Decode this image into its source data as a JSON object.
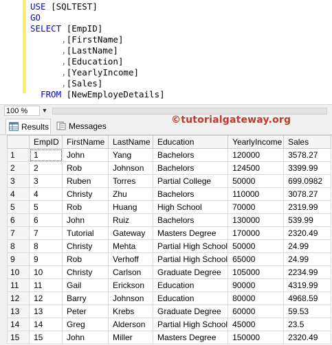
{
  "editor": {
    "lines": [
      {
        "t1": "USE ",
        "t2": "[SQLTEST]"
      },
      {
        "t1": "GO",
        "t2": ""
      },
      {
        "t1": "SELECT ",
        "t2": "[EmpID]"
      },
      {
        "t1": "      ,",
        "t2": "[FirstName]"
      },
      {
        "t1": "      ,",
        "t2": "[LastName]"
      },
      {
        "t1": "      ,",
        "t2": "[Education]"
      },
      {
        "t1": "      ,",
        "t2": "[YearlyIncome]"
      },
      {
        "t1": "      ,",
        "t2": "[Sales]"
      },
      {
        "t1": "FROM ",
        "t2": "[NewEmployeDetails]"
      }
    ]
  },
  "zoom": {
    "value": "100 %"
  },
  "tabs": {
    "results": "Results",
    "messages": "Messages"
  },
  "watermark": "©tutorialgateway.org",
  "grid": {
    "columns": [
      "EmpID",
      "FirstName",
      "LastName",
      "Education",
      "YearlyIncome",
      "Sales"
    ],
    "rows": [
      [
        "1",
        "1",
        "John",
        "Yang",
        "Bachelors",
        "120000",
        "3578.27"
      ],
      [
        "2",
        "2",
        "Rob",
        "Johnson",
        "Bachelors",
        "124500",
        "3399.99"
      ],
      [
        "3",
        "3",
        "Ruben",
        "Torres",
        "Partial College",
        "50000",
        "699.0982"
      ],
      [
        "4",
        "4",
        "Christy",
        "Zhu",
        "Bachelors",
        "110000",
        "3078.27"
      ],
      [
        "5",
        "5",
        "Rob",
        "Huang",
        "High School",
        "70000",
        "2319.99"
      ],
      [
        "6",
        "6",
        "John",
        "Ruiz",
        "Bachelors",
        "130000",
        "539.99"
      ],
      [
        "7",
        "7",
        "Tutorial",
        "Gateway",
        "Masters Degree",
        "170000",
        "2320.49"
      ],
      [
        "8",
        "8",
        "Christy",
        "Mehta",
        "Partial High School",
        "50000",
        "24.99"
      ],
      [
        "9",
        "9",
        "Rob",
        "Verhoff",
        "Partial High School",
        "65000",
        "24.99"
      ],
      [
        "10",
        "10",
        "Christy",
        "Carlson",
        "Graduate Degree",
        "105000",
        "2234.99"
      ],
      [
        "11",
        "11",
        "Gail",
        "Erickson",
        "Education",
        "90000",
        "4319.99"
      ],
      [
        "12",
        "12",
        "Barry",
        "Johnson",
        "Education",
        "80000",
        "4968.59"
      ],
      [
        "13",
        "13",
        "Peter",
        "Krebs",
        "Graduate Degree",
        "60000",
        "59.53"
      ],
      [
        "14",
        "14",
        "Greg",
        "Alderson",
        "Partial High School",
        "45000",
        "23.5"
      ],
      [
        "15",
        "15",
        "John",
        "Miller",
        "Masters Degree",
        "150000",
        "2320.49"
      ]
    ]
  }
}
